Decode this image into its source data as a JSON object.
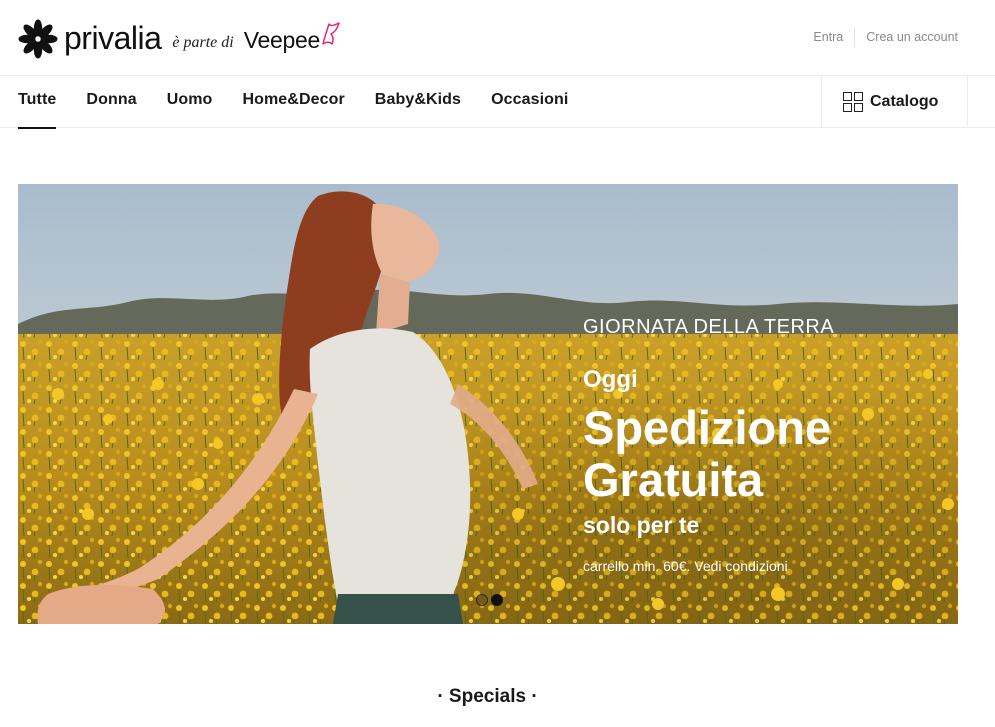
{
  "header": {
    "logo_text": "privalia",
    "logo_part": "è parte di",
    "logo_partner": "Veepee",
    "auth": {
      "login": "Entra",
      "register": "Crea un account"
    }
  },
  "nav": {
    "items": [
      {
        "label": "Tutte",
        "active": true
      },
      {
        "label": "Donna",
        "active": false
      },
      {
        "label": "Uomo",
        "active": false
      },
      {
        "label": "Home&Decor",
        "active": false
      },
      {
        "label": "Baby&Kids",
        "active": false
      },
      {
        "label": "Occasioni",
        "active": false
      }
    ],
    "catalog_label": "Catalogo"
  },
  "hero": {
    "kicker": "GIORNATA DELLA TERRA",
    "today": "Oggi",
    "headline_line1": "Spedizione",
    "headline_line2": "Gratuita",
    "subheadline": "solo per te",
    "fine_print": "carrello min. 60€. Vedi condizioni",
    "slides_total": 2,
    "slide_active": 2
  },
  "section": {
    "title": "· Specials ·"
  },
  "colors": {
    "brand_butterfly": "#e8197d",
    "text": "#1a1a1a",
    "muted": "#8a8a8a",
    "field_yellow": "#d8a91c"
  }
}
